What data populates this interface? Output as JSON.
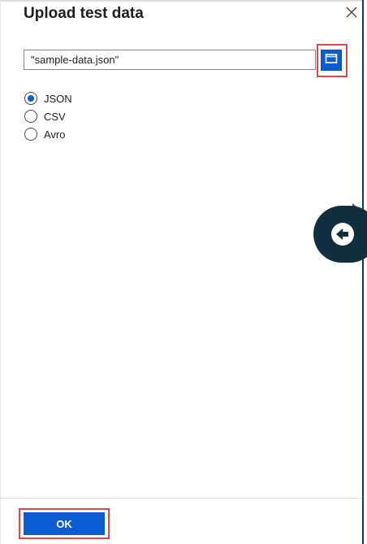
{
  "panel": {
    "title": "Upload test data",
    "close_icon": "close-icon"
  },
  "file": {
    "value": "\"sample-data.json\"",
    "browse_icon": "folder-icon"
  },
  "format": {
    "options": [
      {
        "label": "JSON",
        "selected": true
      },
      {
        "label": "CSV",
        "selected": false
      },
      {
        "label": "Avro",
        "selected": false
      }
    ]
  },
  "footer": {
    "ok_label": "OK"
  },
  "side": {
    "back_icon": "arrow-left-icon"
  },
  "colors": {
    "accent": "#0b5cd5",
    "highlight": "#e0454c",
    "pill": "#0f2f3f"
  }
}
